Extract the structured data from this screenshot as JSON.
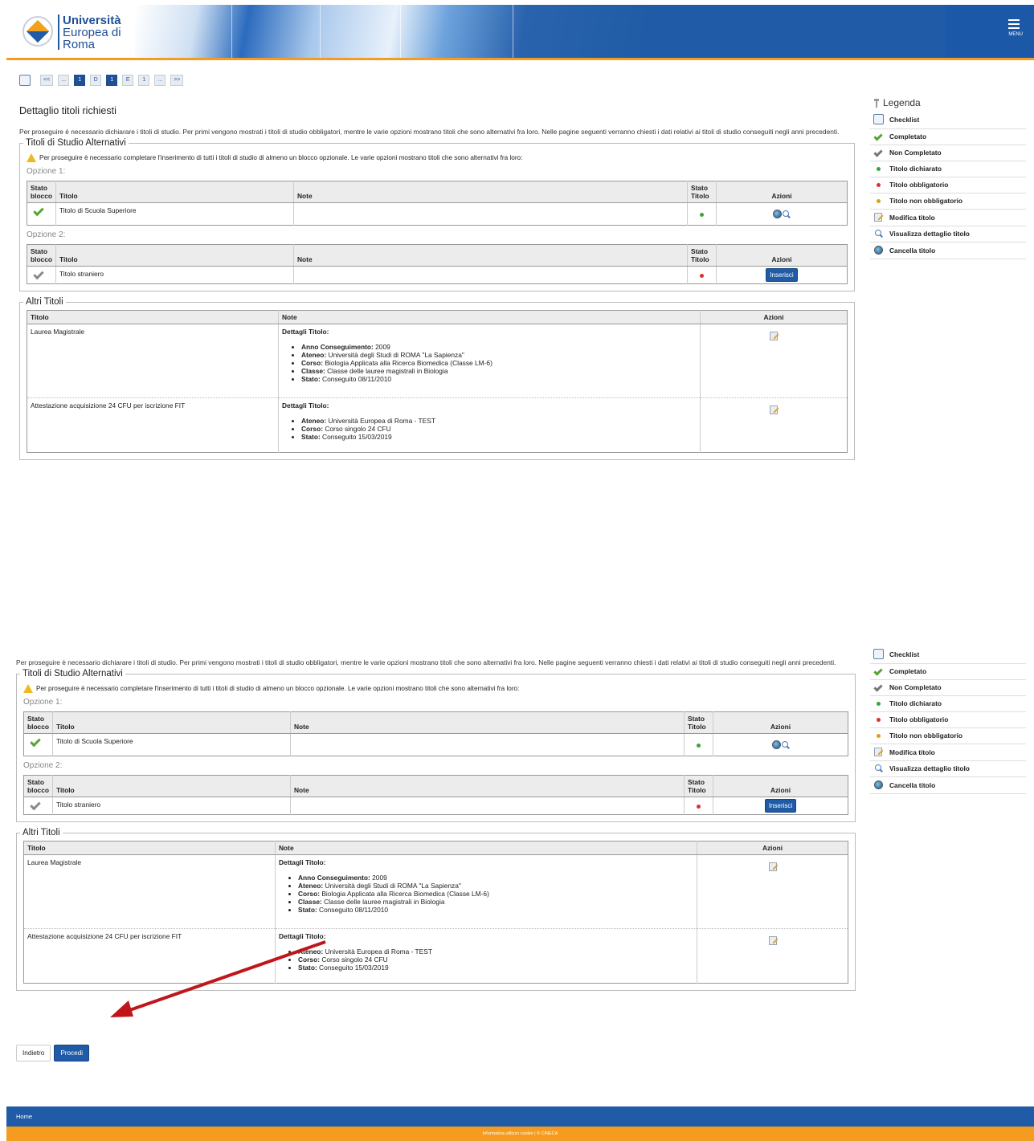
{
  "header": {
    "logo_line1": "Università",
    "logo_line2": "Europea di",
    "logo_line3": "Roma",
    "menu_label": "MENU"
  },
  "breadcrumb": [
    "<<",
    "...",
    "1",
    "D",
    "1",
    "E",
    "1",
    "...",
    ">>"
  ],
  "page": {
    "title": "Dettaglio titoli richiesti",
    "intro": "Per proseguire è necessario dichiarare i titoli di studio. Per primi vengono mostrati i titoli di studio obbligatori, mentre le varie opzioni mostrano titoli che sono alternativi fra loro. Nelle pagine seguenti verranno chiesti i dati relativi ai titoli di studio conseguiti negli anni precedenti."
  },
  "alternativi": {
    "legend": "Titoli di Studio Alternativi",
    "warning": "Per proseguire è necessario completare l'inserimento di tutti i titoli di studio di almeno un blocco opzionale. Le varie opzioni mostrano titoli che sono alternativi fra loro:",
    "headers": {
      "stato_blocco_1": "Stato",
      "stato_blocco_2": "blocco",
      "titolo": "Titolo",
      "note": "Note",
      "stato_titolo_1": "Stato",
      "stato_titolo_2": "Titolo",
      "azioni": "Azioni"
    },
    "opzione1": {
      "label": "Opzione 1:",
      "titolo": "Titolo di Scuola Superiore",
      "note": ""
    },
    "opzione2": {
      "label": "Opzione 2:",
      "titolo": "Titolo straniero",
      "note": "",
      "button": "Inserisci"
    }
  },
  "altri": {
    "legend": "Altri Titoli",
    "headers": {
      "titolo": "Titolo",
      "note": "Note",
      "azioni": "Azioni"
    },
    "rows": [
      {
        "titolo": "Laurea Magistrale",
        "det_title": "Dettagli Titolo:",
        "details": [
          {
            "k": "Anno Conseguimento:",
            "v": " 2009"
          },
          {
            "k": "Ateneo:",
            "v": " Università degli Studi di ROMA \"La Sapienza\""
          },
          {
            "k": "Corso:",
            "v": " Biologia Applicata alla Ricerca Biomedica (Classe LM-6)"
          },
          {
            "k": "Classe:",
            "v": " Classe delle lauree magistrali in Biologia"
          },
          {
            "k": "Stato:",
            "v": " Conseguito 08/11/2010"
          }
        ]
      },
      {
        "titolo": "Attestazione acquisizione 24 CFU per iscrizione FIT",
        "det_title": "Dettagli Titolo:",
        "details": [
          {
            "k": "Ateneo:",
            "v": " Università Europea di Roma - TEST"
          },
          {
            "k": "Corso:",
            "v": " Corso singolo 24 CFU"
          },
          {
            "k": "Stato:",
            "v": " Conseguito 15/03/2019"
          }
        ]
      }
    ]
  },
  "legenda": {
    "title": "Legenda",
    "items": [
      "Checklist",
      "Completato",
      "Non Completato",
      "Titolo dichiarato",
      "Titolo obbligatorio",
      "Titolo non obbligatorio",
      "Modifica titolo",
      "Visualizza dettaglio titolo",
      "Cancella titolo"
    ]
  },
  "buttons": {
    "back": "Indietro",
    "next": "Procedi"
  },
  "footer": {
    "home": "Home",
    "bottom": "Informativa utilizzo cookie | © CINECA"
  },
  "colors": {
    "brand_blue": "#1f5ba6",
    "accent_orange": "#f39c1f",
    "arrow_red": "#c0161b"
  }
}
